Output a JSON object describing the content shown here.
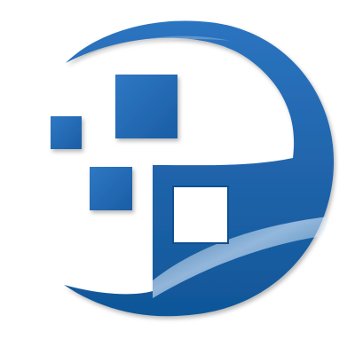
{
  "logo": {
    "name": "abstract-blue-crescent-with-squares",
    "colors": {
      "primary": "#1f63a9",
      "dark": "#0d4f92",
      "light": "#4c8fd2",
      "highlight": "#c6dcf3",
      "background": "#ffffff"
    }
  }
}
